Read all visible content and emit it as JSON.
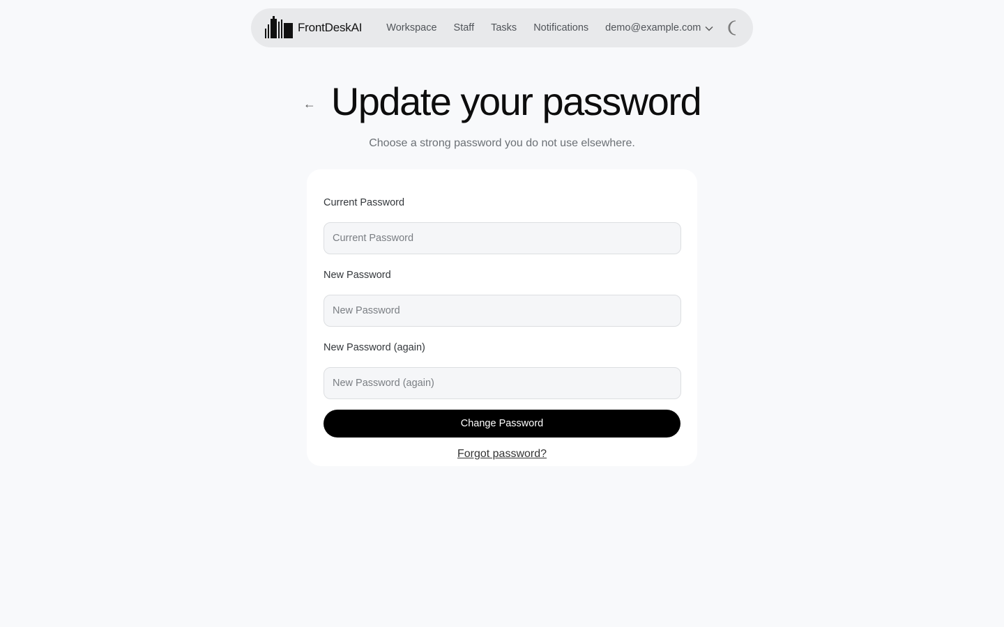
{
  "nav": {
    "brand": "FrontDeskAI",
    "links": [
      "Workspace",
      "Staff",
      "Tasks",
      "Notifications"
    ],
    "user_email": "demo@example.com",
    "icons": {
      "logo": "building-skyline-logo",
      "user_menu": "chevron-down-icon",
      "theme": "moon-icon"
    }
  },
  "page": {
    "back_icon": "←",
    "title": "Update your password",
    "subtitle": "Choose a strong password you do not use elsewhere."
  },
  "form": {
    "fields": [
      {
        "label": "Current Password",
        "placeholder": "Current Password",
        "value": ""
      },
      {
        "label": "New Password",
        "placeholder": "New Password",
        "value": ""
      },
      {
        "label": "New Password (again)",
        "placeholder": "New Password (again)",
        "value": ""
      }
    ],
    "submit_label": "Change Password",
    "forgot_label": "Forgot password?"
  },
  "colors": {
    "background": "#f8f9fb",
    "nav_background": "#e8e9eb",
    "card_background": "#ffffff",
    "primary_button": "#000000",
    "primary_button_text": "#ffffff",
    "input_background": "#f5f6f8"
  }
}
